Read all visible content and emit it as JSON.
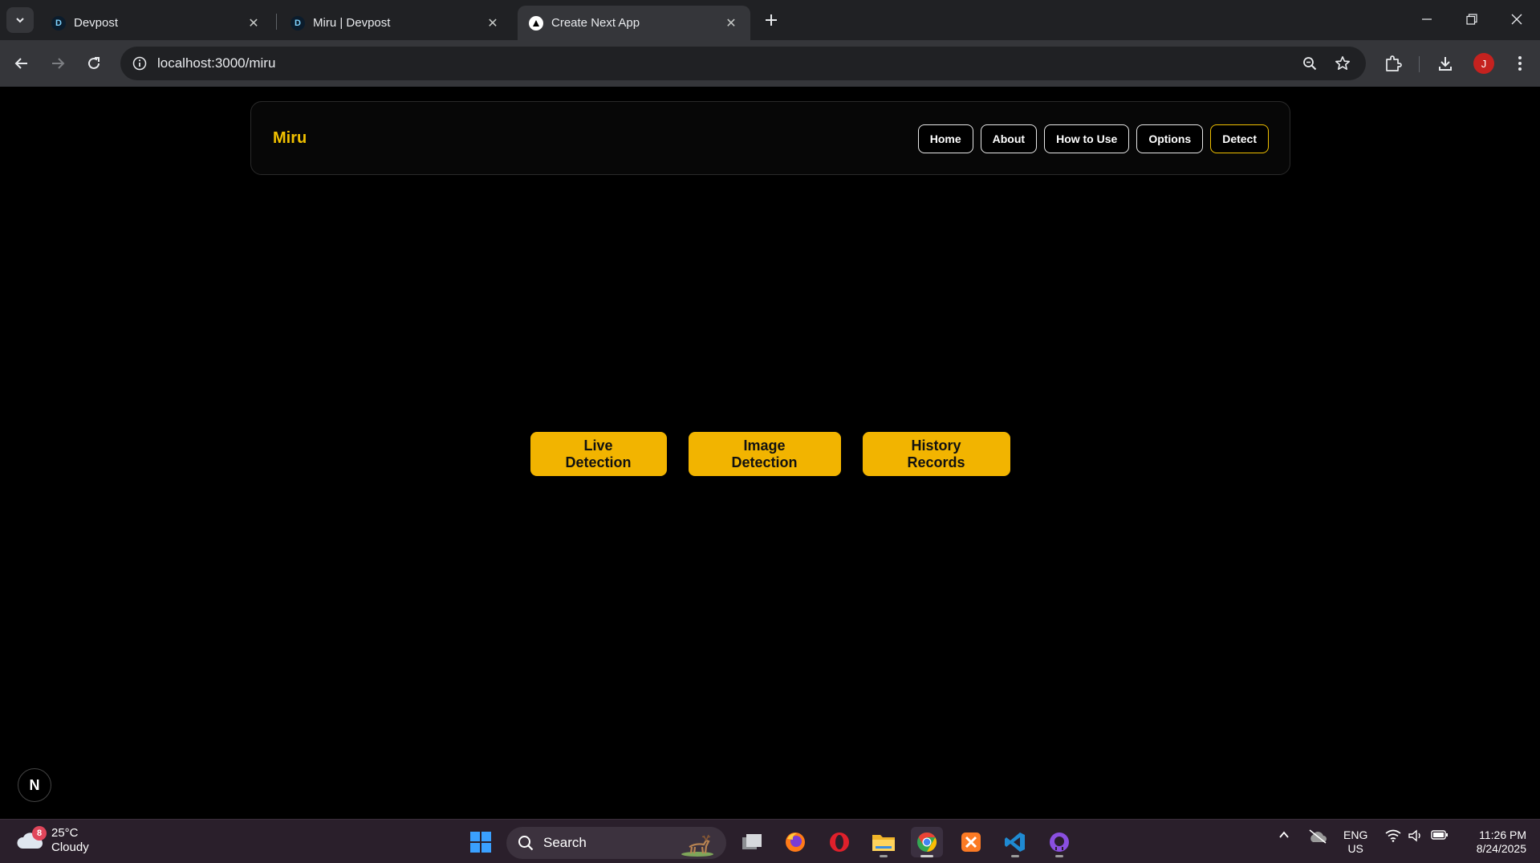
{
  "browser": {
    "tabs": [
      {
        "title": "Devpost",
        "favicon": "D",
        "active": false
      },
      {
        "title": "Miru | Devpost",
        "favicon": "D",
        "active": false
      },
      {
        "title": "Create Next App",
        "favicon": "next-triangle",
        "active": true
      }
    ],
    "url": "localhost:3000/miru",
    "profile_initial": "J"
  },
  "page": {
    "brand": "Miru",
    "nav": [
      {
        "label": "Home"
      },
      {
        "label": "About"
      },
      {
        "label": "How to Use"
      },
      {
        "label": "Options"
      },
      {
        "label": "Detect",
        "active": true
      }
    ],
    "actions": [
      {
        "label": "Live Detection"
      },
      {
        "label": "Image Detection"
      },
      {
        "label": "History Records"
      }
    ],
    "dev_badge": "N"
  },
  "colors": {
    "accent": "#f2b400",
    "brand_text": "#f0c000",
    "background": "#000000"
  },
  "taskbar": {
    "weather": {
      "temp": "25°C",
      "condition": "Cloudy",
      "badge": "8"
    },
    "search_label": "Search",
    "language": {
      "line1": "ENG",
      "line2": "US"
    },
    "clock": {
      "time": "11:26 PM",
      "date": "8/24/2025"
    }
  }
}
